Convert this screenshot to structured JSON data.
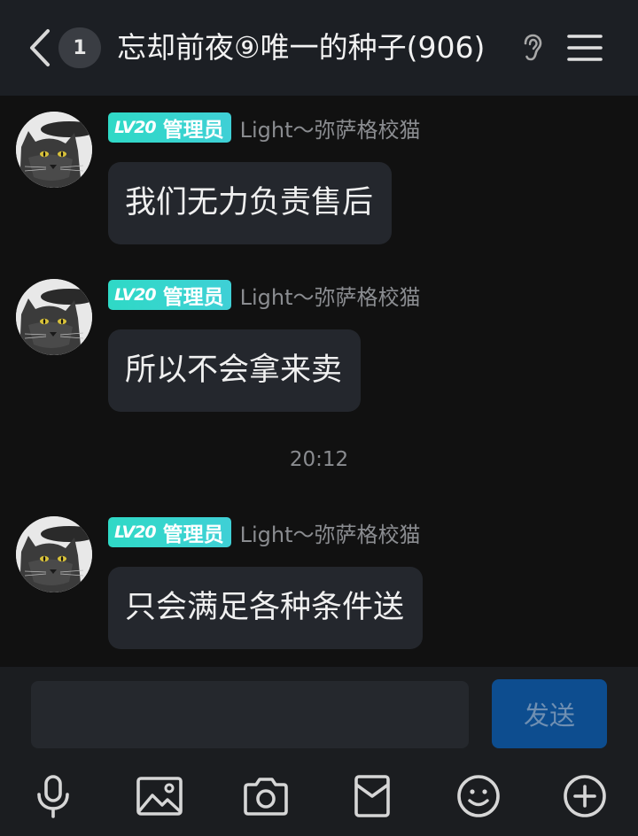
{
  "header": {
    "unread_count": "1",
    "title": "忘却前夜⑨唯一的种子(906)"
  },
  "messages": [
    {
      "level": "LV20",
      "role": "管理员",
      "sender": "Light～弥萨格校猫",
      "text": "我们无力负责售后"
    },
    {
      "level": "LV20",
      "role": "管理员",
      "sender": "Light～弥萨格校猫",
      "text": "所以不会拿来卖"
    },
    {
      "level": "LV20",
      "role": "管理员",
      "sender": "Light～弥萨格校猫",
      "text": "只会满足各种条件送"
    }
  ],
  "timestamp": "20:12",
  "composer": {
    "input_value": "",
    "send_label": "发送"
  },
  "toolbar": {
    "icons": [
      "microphone-icon",
      "image-icon",
      "camera-icon",
      "red-packet-icon",
      "emoji-icon",
      "plus-icon"
    ]
  },
  "colors": {
    "badge": "#2fd9c6",
    "send_button": "#0d4d8f",
    "bubble": "#24272d"
  }
}
